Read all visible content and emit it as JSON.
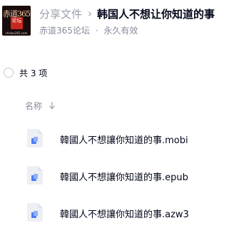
{
  "header": {
    "avatar": {
      "logo_text": "赤道365",
      "seal_text": "论坛",
      "sub_text": "chidao365.com"
    },
    "breadcrumb": {
      "root": "分享文件",
      "separator": "›",
      "title": "韩国人不想让你知道的事"
    },
    "meta": {
      "owner": "赤道365论坛",
      "separator": "·",
      "validity": "永久有效"
    }
  },
  "list": {
    "count_text": "共 3 项",
    "column_name": "名称",
    "sort_icon": "arrow-down-icon",
    "files": [
      {
        "name": "韓國人不想讓你知道的事.mobi",
        "icon": "ebook-file-icon"
      },
      {
        "name": "韓國人不想讓你知道的事.epub",
        "icon": "ebook-file-icon"
      },
      {
        "name": "韓國人不想讓你知道的事.azw3",
        "icon": "ebook-file-icon"
      }
    ]
  },
  "colors": {
    "text_primary": "#03081a",
    "text_secondary": "#878c9c",
    "icon_blue": "#4d7cf5",
    "icon_bg": "#eceff4"
  }
}
